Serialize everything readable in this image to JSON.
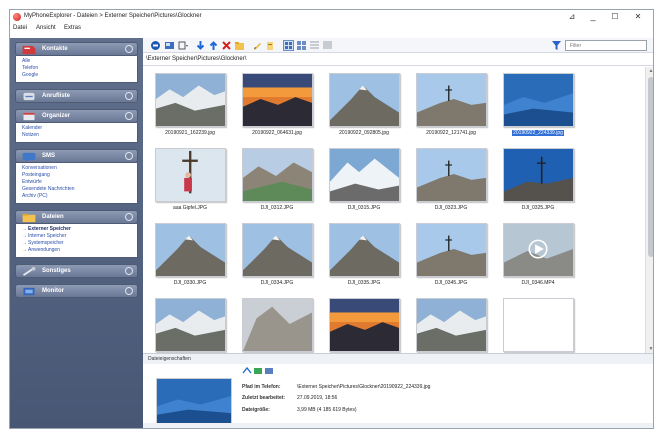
{
  "window": {
    "title": "MyPhoneExplorer - Dateien > Externer Speicher\\Pictures\\Glockner",
    "controls": [
      "_",
      "☐",
      "✕"
    ]
  },
  "menu": [
    "Datei",
    "Ansicht",
    "Extras"
  ],
  "sidebar": {
    "panels": [
      {
        "title": "Kontakte",
        "icon": "contacts-icon",
        "links": [
          "Alle",
          "Telefon",
          "Google"
        ]
      },
      {
        "title": "Anrufliste",
        "icon": "phone-icon",
        "links": []
      },
      {
        "title": "Organizer",
        "icon": "organizer-icon",
        "links": [
          "Kalender",
          "Notizen"
        ]
      },
      {
        "title": "SMS",
        "icon": "sms-icon",
        "links": [
          "Konversationen",
          "Posteingang",
          "Entwürfe",
          "Gesendete Nachrichten",
          "Archiv (PC)"
        ]
      },
      {
        "title": "Dateien",
        "icon": "folder-icon",
        "links": [
          "Externer Speicher",
          "Interner Speicher",
          "Systemspeicher",
          "Anwendungen"
        ],
        "active": "Externer Speicher"
      },
      {
        "title": "Sonstiges",
        "icon": "misc-icon",
        "links": []
      },
      {
        "title": "Monitor",
        "icon": "monitor-icon",
        "links": []
      }
    ]
  },
  "toolbar": {
    "filter_placeholder": "Filter"
  },
  "path": "\\Externer Speicher\\Pictures\\Glockner\\",
  "files": [
    {
      "name": "20190921_162239.jpg",
      "scene": "valley"
    },
    {
      "name": "20190922_064631.jpg",
      "scene": "sunset"
    },
    {
      "name": "20190922_092805.jpg",
      "scene": "peak"
    },
    {
      "name": "20190922_121741.jpg",
      "scene": "summit"
    },
    {
      "name": "20190922_224339.jpg",
      "scene": "bluehaze",
      "selected": true
    },
    {
      "name": "aaa Gipfel.JPG",
      "scene": "cross"
    },
    {
      "name": "DJI_0312.JPG",
      "scene": "ridge"
    },
    {
      "name": "DJI_0315.JPG",
      "scene": "glacier"
    },
    {
      "name": "DJI_0323.JPG",
      "scene": "summit"
    },
    {
      "name": "DJI_0325.JPG",
      "scene": "crossblue"
    },
    {
      "name": "DJI_0330.JPG",
      "scene": "peak"
    },
    {
      "name": "DJI_0334.JPG",
      "scene": "peak"
    },
    {
      "name": "DJI_0335.JPG",
      "scene": "peak"
    },
    {
      "name": "DJI_0345.JPG",
      "scene": "summit"
    },
    {
      "name": "DJI_0346.MP4",
      "scene": "video"
    },
    {
      "name": "",
      "scene": "valley"
    },
    {
      "name": "",
      "scene": "rock"
    },
    {
      "name": "",
      "scene": "sunset"
    },
    {
      "name": "",
      "scene": "valley"
    },
    {
      "name": "",
      "scene": "blank"
    }
  ],
  "properties": {
    "title": "Dateieigenschaften",
    "rows": [
      {
        "label": "Pfad im Telefon:",
        "value": "\\Externer Speicher\\Pictures\\Glockner\\20190922_224339.jpg"
      },
      {
        "label": "Zuletzt bearbeitet:",
        "value": "27.09.2019, 18:56"
      },
      {
        "label": "Dateigröße:",
        "value": "3,99 MB  (4 185 619 Bytes)"
      }
    ]
  },
  "colors": {
    "selection": "#2f6fd6",
    "sidebar": "#5f6f8c"
  }
}
